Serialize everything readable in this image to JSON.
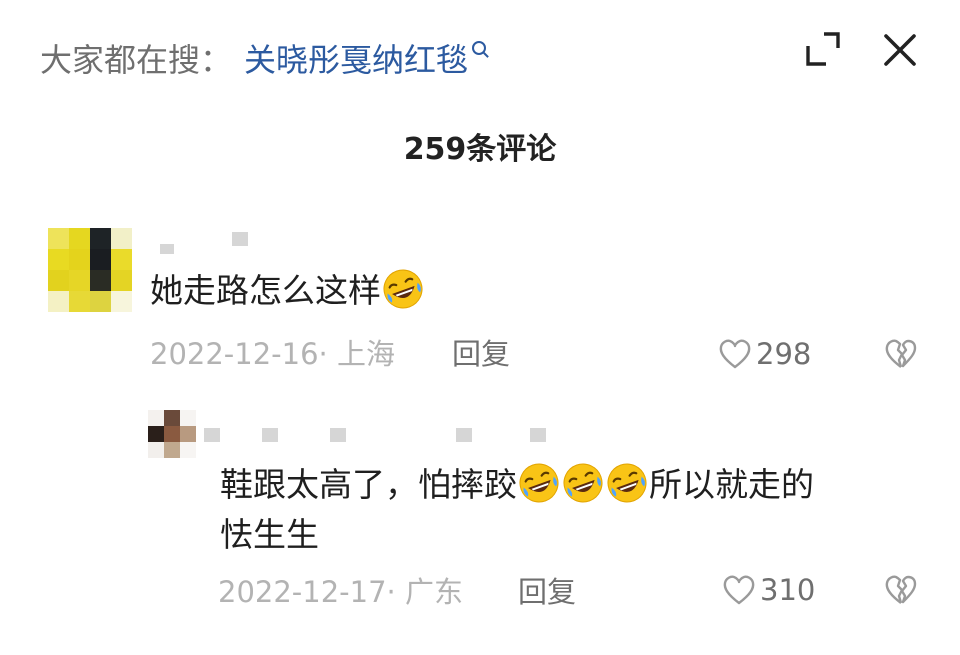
{
  "header": {
    "search_prefix": "大家都在搜：",
    "search_term": "关晓彤戛纳红毯",
    "comment_count": "259条评论"
  },
  "comments": [
    {
      "text": "她走路怎么这样",
      "emoji": "rolling-on-floor-laughing",
      "date_location": "2022-12-16· 上海",
      "reply_label": "回复",
      "likes": "298"
    }
  ],
  "reply": {
    "text_line1_a": "鞋跟太高了，怕摔跤",
    "text_line1_b": "所以就走的",
    "text_line2": "怯生生",
    "emoji": "rolling-on-floor-laughing",
    "emoji_count": 3,
    "date_location": "2022-12-17· 广东",
    "reply_label": "回复",
    "likes": "310"
  },
  "colors": {
    "search_term": "#2c5aa0",
    "muted_text": "#b3b3b3",
    "secondary_text": "#6f6f6f"
  },
  "icons": [
    "magnifier-icon",
    "expand-icon",
    "close-icon",
    "heart-icon",
    "broken-heart-icon",
    "laughing-emoji-icon"
  ]
}
